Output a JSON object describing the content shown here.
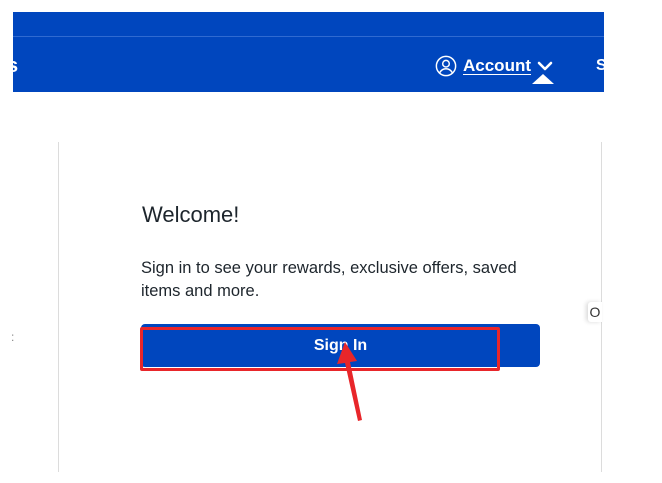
{
  "header": {
    "nav_left_partial": "s",
    "nav_right_partial": "S",
    "account_label": "Account",
    "account_icon": "user-circle-icon",
    "chevron_icon": "chevron-down-icon"
  },
  "panel": {
    "title": "Welcome!",
    "description": "Sign in to see your rewards, exclusive offers, saved items and more.",
    "signin_label": "Sign In"
  },
  "edges": {
    "left_mark": ":",
    "right_mark": "O"
  },
  "colors": {
    "brand_blue": "#0046be",
    "highlight_red": "#e8262a"
  }
}
